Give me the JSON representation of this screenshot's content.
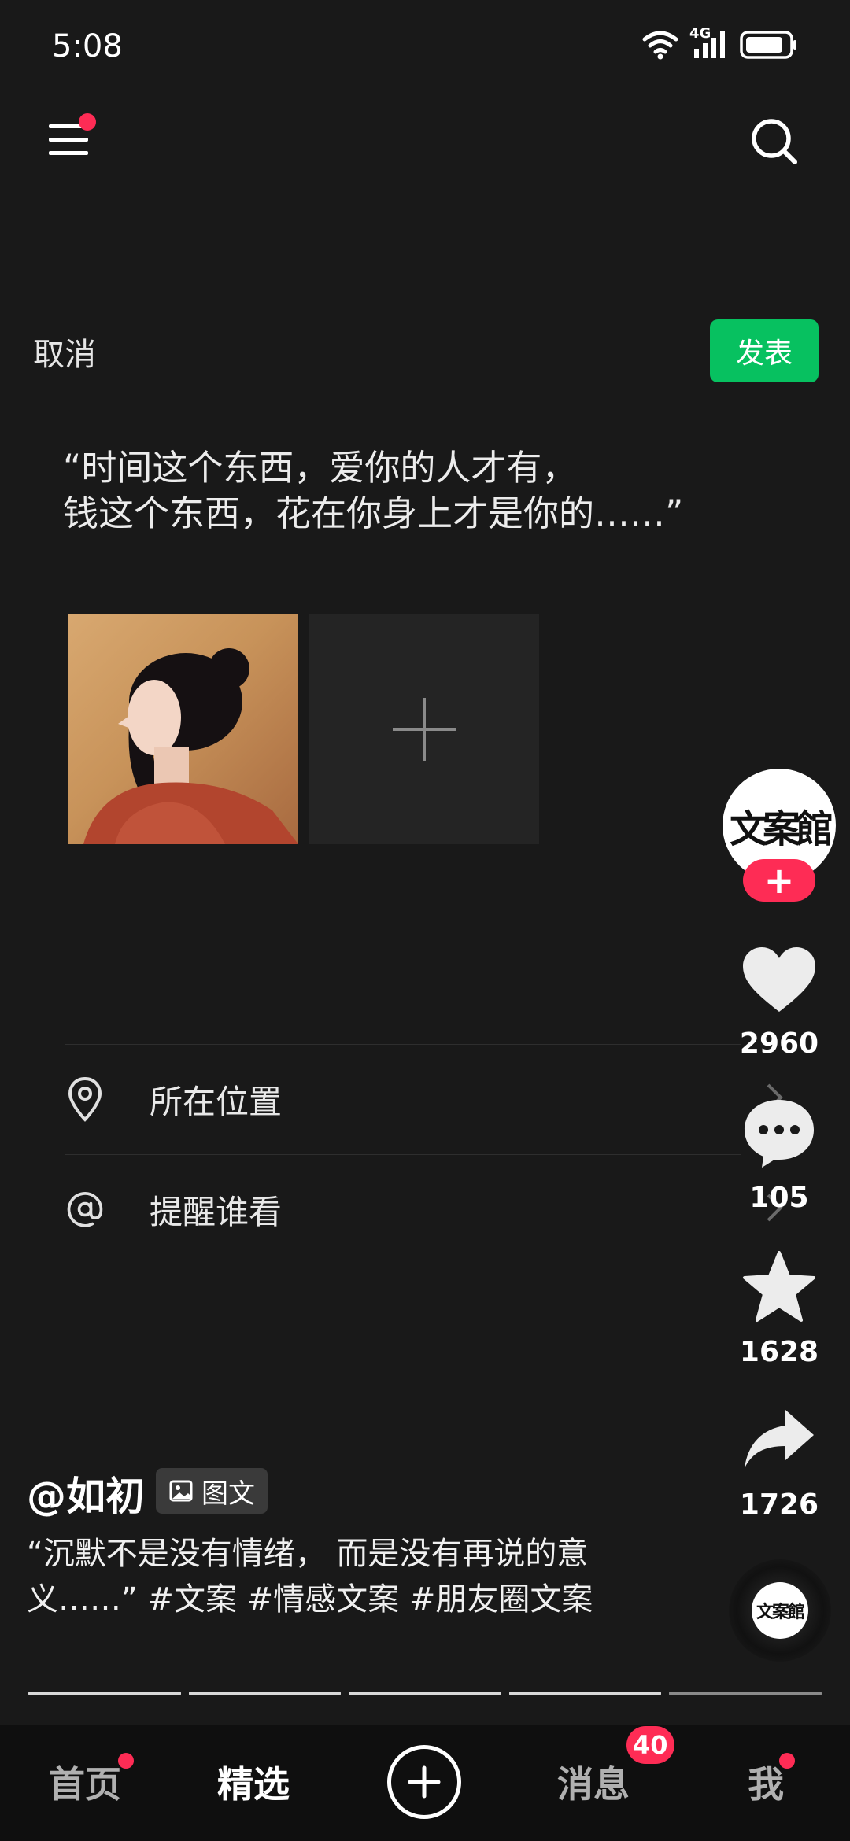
{
  "status_bar": {
    "time": "5:08",
    "network": "4G"
  },
  "top_bar": {
    "menu_icon": "menu-icon",
    "search_icon": "search-icon"
  },
  "compose": {
    "cancel_label": "取消",
    "publish_label": "发表",
    "quote_text": "“时间这个东西，爱你的人才有，\n  钱这个东西，花在你身上才是你的……”",
    "add_image_icon": "plus-icon",
    "options": [
      {
        "label": "所在位置",
        "icon": "location-pin-icon"
      },
      {
        "label": "提醒谁看",
        "icon": "at-sign-icon"
      }
    ]
  },
  "side_rail": {
    "avatar_text": "文案館",
    "like_count": "2960",
    "comment_count": "105",
    "favorite_count": "1628",
    "share_count": "1726",
    "music_disc_text": "文案館"
  },
  "post": {
    "author": "@如初",
    "type_label": "图文",
    "caption": "“沉默不是没有情绪， 而是没有再说的意义……” #文案 #情感文案 #朋友圈文案"
  },
  "progress": {
    "total_segments": 5,
    "viewed_segments": 4
  },
  "bottom_nav": {
    "items": [
      {
        "label": "首页"
      },
      {
        "label": "精选"
      },
      {
        "label": "消息",
        "badge": "40"
      },
      {
        "label": "我"
      }
    ],
    "active": "精选"
  },
  "colors": {
    "background": "#191919",
    "accent_green": "#07c160",
    "accent_red": "#fe2c55"
  }
}
